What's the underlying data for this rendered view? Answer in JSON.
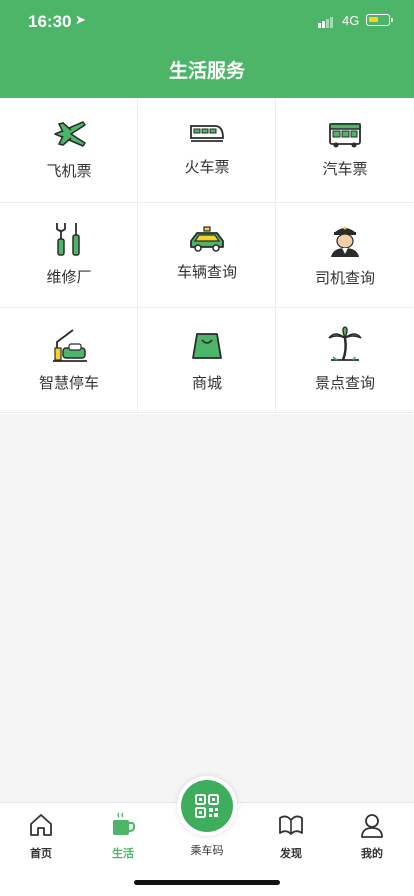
{
  "status_bar": {
    "time": "16:30",
    "network": "4G"
  },
  "header": {
    "title": "生活服务"
  },
  "services": [
    {
      "label": "飞机票",
      "icon": "airplane-icon"
    },
    {
      "label": "火车票",
      "icon": "train-icon"
    },
    {
      "label": "汽车票",
      "icon": "bus-icon"
    },
    {
      "label": "维修厂",
      "icon": "wrench-screwdriver-icon"
    },
    {
      "label": "车辆查询",
      "icon": "car-icon"
    },
    {
      "label": "司机查询",
      "icon": "driver-icon"
    },
    {
      "label": "智慧停车",
      "icon": "parking-gate-icon"
    },
    {
      "label": "商城",
      "icon": "shopping-bag-icon"
    },
    {
      "label": "景点查询",
      "icon": "palm-tree-icon"
    }
  ],
  "tabbar": {
    "home": "首页",
    "life": "生活",
    "ride_code": "乘车码",
    "discover": "发现",
    "mine": "我的"
  },
  "colors": {
    "primary": "#4cb567",
    "icon_green": "#3fae5c",
    "icon_yellow": "#f7d32a"
  }
}
